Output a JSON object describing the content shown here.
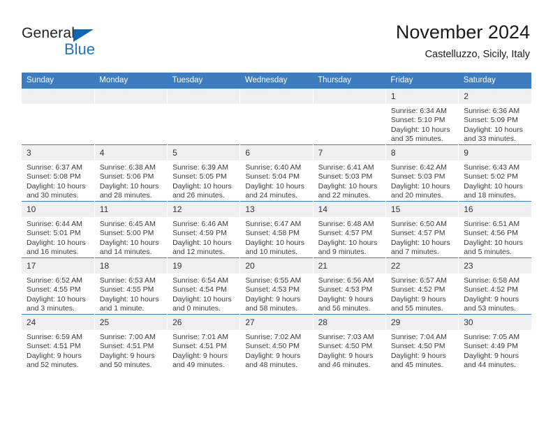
{
  "brand": {
    "name_part1": "General",
    "name_part2": "Blue",
    "triangle_color": "#1066b0",
    "blue_color": "#1b75bc"
  },
  "header": {
    "title": "November 2024",
    "subtitle": "Castelluzzo, Sicily, Italy"
  },
  "theme": {
    "header_row_bg": "#3d7cbe",
    "daynum_bg": "#efefef",
    "grid_line": "#3d7cbe",
    "text": "#3a3a3a"
  },
  "weekdays": [
    "Sunday",
    "Monday",
    "Tuesday",
    "Wednesday",
    "Thursday",
    "Friday",
    "Saturday"
  ],
  "weeks": [
    [
      {
        "day": "",
        "empty": true,
        "sunrise": "",
        "sunset": "",
        "daylight1": "",
        "daylight2": ""
      },
      {
        "day": "",
        "empty": true,
        "sunrise": "",
        "sunset": "",
        "daylight1": "",
        "daylight2": ""
      },
      {
        "day": "",
        "empty": true,
        "sunrise": "",
        "sunset": "",
        "daylight1": "",
        "daylight2": ""
      },
      {
        "day": "",
        "empty": true,
        "sunrise": "",
        "sunset": "",
        "daylight1": "",
        "daylight2": ""
      },
      {
        "day": "",
        "empty": true,
        "sunrise": "",
        "sunset": "",
        "daylight1": "",
        "daylight2": ""
      },
      {
        "day": "1",
        "empty": false,
        "sunrise": "Sunrise: 6:34 AM",
        "sunset": "Sunset: 5:10 PM",
        "daylight1": "Daylight: 10 hours",
        "daylight2": "and 35 minutes."
      },
      {
        "day": "2",
        "empty": false,
        "sunrise": "Sunrise: 6:36 AM",
        "sunset": "Sunset: 5:09 PM",
        "daylight1": "Daylight: 10 hours",
        "daylight2": "and 33 minutes."
      }
    ],
    [
      {
        "day": "3",
        "empty": false,
        "sunrise": "Sunrise: 6:37 AM",
        "sunset": "Sunset: 5:08 PM",
        "daylight1": "Daylight: 10 hours",
        "daylight2": "and 30 minutes."
      },
      {
        "day": "4",
        "empty": false,
        "sunrise": "Sunrise: 6:38 AM",
        "sunset": "Sunset: 5:06 PM",
        "daylight1": "Daylight: 10 hours",
        "daylight2": "and 28 minutes."
      },
      {
        "day": "5",
        "empty": false,
        "sunrise": "Sunrise: 6:39 AM",
        "sunset": "Sunset: 5:05 PM",
        "daylight1": "Daylight: 10 hours",
        "daylight2": "and 26 minutes."
      },
      {
        "day": "6",
        "empty": false,
        "sunrise": "Sunrise: 6:40 AM",
        "sunset": "Sunset: 5:04 PM",
        "daylight1": "Daylight: 10 hours",
        "daylight2": "and 24 minutes."
      },
      {
        "day": "7",
        "empty": false,
        "sunrise": "Sunrise: 6:41 AM",
        "sunset": "Sunset: 5:03 PM",
        "daylight1": "Daylight: 10 hours",
        "daylight2": "and 22 minutes."
      },
      {
        "day": "8",
        "empty": false,
        "sunrise": "Sunrise: 6:42 AM",
        "sunset": "Sunset: 5:03 PM",
        "daylight1": "Daylight: 10 hours",
        "daylight2": "and 20 minutes."
      },
      {
        "day": "9",
        "empty": false,
        "sunrise": "Sunrise: 6:43 AM",
        "sunset": "Sunset: 5:02 PM",
        "daylight1": "Daylight: 10 hours",
        "daylight2": "and 18 minutes."
      }
    ],
    [
      {
        "day": "10",
        "empty": false,
        "sunrise": "Sunrise: 6:44 AM",
        "sunset": "Sunset: 5:01 PM",
        "daylight1": "Daylight: 10 hours",
        "daylight2": "and 16 minutes."
      },
      {
        "day": "11",
        "empty": false,
        "sunrise": "Sunrise: 6:45 AM",
        "sunset": "Sunset: 5:00 PM",
        "daylight1": "Daylight: 10 hours",
        "daylight2": "and 14 minutes."
      },
      {
        "day": "12",
        "empty": false,
        "sunrise": "Sunrise: 6:46 AM",
        "sunset": "Sunset: 4:59 PM",
        "daylight1": "Daylight: 10 hours",
        "daylight2": "and 12 minutes."
      },
      {
        "day": "13",
        "empty": false,
        "sunrise": "Sunrise: 6:47 AM",
        "sunset": "Sunset: 4:58 PM",
        "daylight1": "Daylight: 10 hours",
        "daylight2": "and 10 minutes."
      },
      {
        "day": "14",
        "empty": false,
        "sunrise": "Sunrise: 6:48 AM",
        "sunset": "Sunset: 4:57 PM",
        "daylight1": "Daylight: 10 hours",
        "daylight2": "and 9 minutes."
      },
      {
        "day": "15",
        "empty": false,
        "sunrise": "Sunrise: 6:50 AM",
        "sunset": "Sunset: 4:57 PM",
        "daylight1": "Daylight: 10 hours",
        "daylight2": "and 7 minutes."
      },
      {
        "day": "16",
        "empty": false,
        "sunrise": "Sunrise: 6:51 AM",
        "sunset": "Sunset: 4:56 PM",
        "daylight1": "Daylight: 10 hours",
        "daylight2": "and 5 minutes."
      }
    ],
    [
      {
        "day": "17",
        "empty": false,
        "sunrise": "Sunrise: 6:52 AM",
        "sunset": "Sunset: 4:55 PM",
        "daylight1": "Daylight: 10 hours",
        "daylight2": "and 3 minutes."
      },
      {
        "day": "18",
        "empty": false,
        "sunrise": "Sunrise: 6:53 AM",
        "sunset": "Sunset: 4:55 PM",
        "daylight1": "Daylight: 10 hours",
        "daylight2": "and 1 minute."
      },
      {
        "day": "19",
        "empty": false,
        "sunrise": "Sunrise: 6:54 AM",
        "sunset": "Sunset: 4:54 PM",
        "daylight1": "Daylight: 10 hours",
        "daylight2": "and 0 minutes."
      },
      {
        "day": "20",
        "empty": false,
        "sunrise": "Sunrise: 6:55 AM",
        "sunset": "Sunset: 4:53 PM",
        "daylight1": "Daylight: 9 hours",
        "daylight2": "and 58 minutes."
      },
      {
        "day": "21",
        "empty": false,
        "sunrise": "Sunrise: 6:56 AM",
        "sunset": "Sunset: 4:53 PM",
        "daylight1": "Daylight: 9 hours",
        "daylight2": "and 56 minutes."
      },
      {
        "day": "22",
        "empty": false,
        "sunrise": "Sunrise: 6:57 AM",
        "sunset": "Sunset: 4:52 PM",
        "daylight1": "Daylight: 9 hours",
        "daylight2": "and 55 minutes."
      },
      {
        "day": "23",
        "empty": false,
        "sunrise": "Sunrise: 6:58 AM",
        "sunset": "Sunset: 4:52 PM",
        "daylight1": "Daylight: 9 hours",
        "daylight2": "and 53 minutes."
      }
    ],
    [
      {
        "day": "24",
        "empty": false,
        "sunrise": "Sunrise: 6:59 AM",
        "sunset": "Sunset: 4:51 PM",
        "daylight1": "Daylight: 9 hours",
        "daylight2": "and 52 minutes."
      },
      {
        "day": "25",
        "empty": false,
        "sunrise": "Sunrise: 7:00 AM",
        "sunset": "Sunset: 4:51 PM",
        "daylight1": "Daylight: 9 hours",
        "daylight2": "and 50 minutes."
      },
      {
        "day": "26",
        "empty": false,
        "sunrise": "Sunrise: 7:01 AM",
        "sunset": "Sunset: 4:51 PM",
        "daylight1": "Daylight: 9 hours",
        "daylight2": "and 49 minutes."
      },
      {
        "day": "27",
        "empty": false,
        "sunrise": "Sunrise: 7:02 AM",
        "sunset": "Sunset: 4:50 PM",
        "daylight1": "Daylight: 9 hours",
        "daylight2": "and 48 minutes."
      },
      {
        "day": "28",
        "empty": false,
        "sunrise": "Sunrise: 7:03 AM",
        "sunset": "Sunset: 4:50 PM",
        "daylight1": "Daylight: 9 hours",
        "daylight2": "and 46 minutes."
      },
      {
        "day": "29",
        "empty": false,
        "sunrise": "Sunrise: 7:04 AM",
        "sunset": "Sunset: 4:50 PM",
        "daylight1": "Daylight: 9 hours",
        "daylight2": "and 45 minutes."
      },
      {
        "day": "30",
        "empty": false,
        "sunrise": "Sunrise: 7:05 AM",
        "sunset": "Sunset: 4:49 PM",
        "daylight1": "Daylight: 9 hours",
        "daylight2": "and 44 minutes."
      }
    ]
  ]
}
